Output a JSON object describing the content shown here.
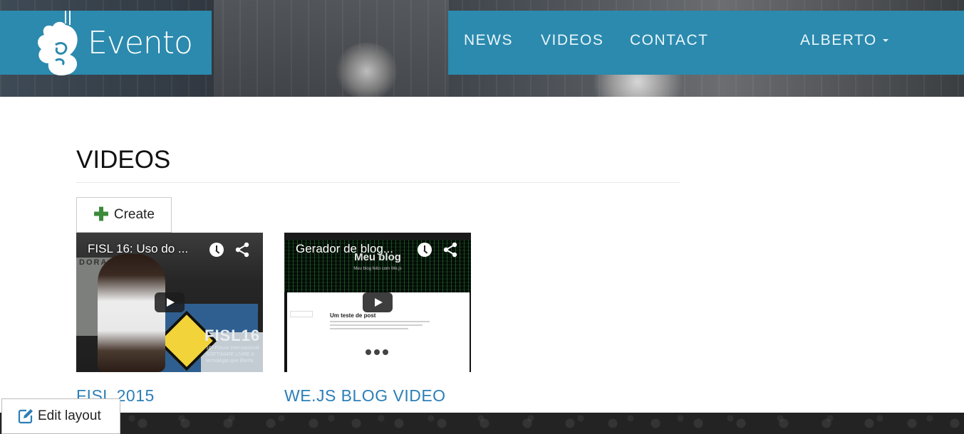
{
  "brand": {
    "name": "Evento"
  },
  "nav": {
    "news": "NEWS",
    "videos": "VIDEOS",
    "contact": "CONTACT",
    "user": "ALBERTO"
  },
  "main": {
    "title": "VIDEOS",
    "create_label": "Create"
  },
  "videos": [
    {
      "overlay_title": "FISL 16: Uso do ...",
      "label": "FISL 2015",
      "thumb_text": {
        "banner": "FISL16",
        "sub": "16º Fórum Internacional SOFTWARE LIVRE A tecnologia que liberta",
        "panel": "DORA"
      }
    },
    {
      "overlay_title": "Gerador de blog...",
      "label": "WE.JS BLOG VIDEO",
      "thumb_text": {
        "blog_title": "Meu blog",
        "blog_sub": "Meu blog feito com We.js",
        "post_title": "Um teste de post"
      }
    }
  ],
  "footer": {
    "edit_layout_label": "Edit layout"
  },
  "icons": {
    "logo": "evento-logo-icon",
    "plus": "plus-icon",
    "clock": "clock-icon",
    "share": "share-icon",
    "play": "play-icon",
    "edit": "edit-icon",
    "caret": "caret-down-icon"
  },
  "colors": {
    "brand": "#2b8aae",
    "link": "#2c7fb8",
    "create_plus": "#3a8a3a"
  }
}
